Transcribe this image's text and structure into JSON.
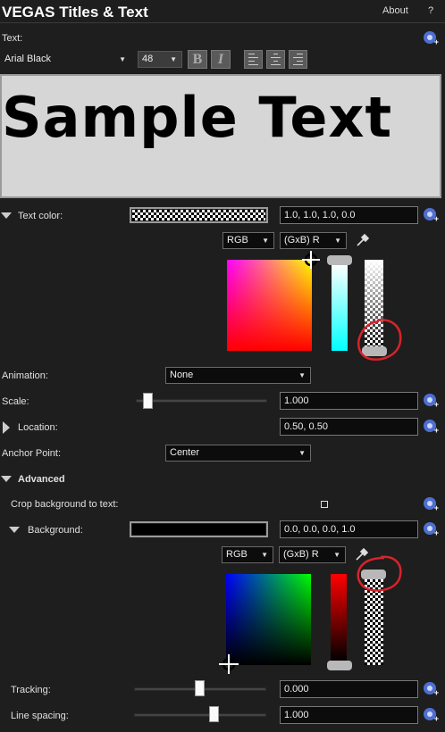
{
  "window": {
    "title": "VEGAS Titles & Text",
    "menu_about": "About",
    "menu_help": "?"
  },
  "text_section": {
    "label": "Text:",
    "font_name": "Arial Black",
    "font_size": "48",
    "bold_label": "B",
    "italic_label": "I",
    "preview_text": "Sample Text"
  },
  "text_color": {
    "label": "Text color:",
    "value": "1.0, 1.0, 1.0, 0.0",
    "mode": "RGB",
    "channel": "(GxB) R"
  },
  "animation": {
    "label": "Animation:",
    "value": "None"
  },
  "scale": {
    "label": "Scale:",
    "value": "1.000",
    "slider_level": 0.08
  },
  "location": {
    "label": "Location:",
    "value": "0.50, 0.50"
  },
  "anchor": {
    "label": "Anchor Point:",
    "value": "Center"
  },
  "advanced": {
    "label": "Advanced",
    "crop_label": "Crop background to text:",
    "crop_checked": false,
    "background": {
      "label": "Background:",
      "value": "0.0, 0.0, 0.0, 1.0",
      "mode": "RGB",
      "channel": "(GxB) R"
    },
    "tracking": {
      "label": "Tracking:",
      "value": "0.000",
      "slider_level": 0.5
    },
    "line_spacing": {
      "label": "Line spacing:",
      "value": "1.000",
      "slider_level": 0.6
    }
  },
  "colors": {
    "accent_plus": "#4e6fd0",
    "annotation_circle": "#d8232a",
    "panel_bg": "#1e1e1e",
    "preview_bg": "#d6d6d6"
  }
}
